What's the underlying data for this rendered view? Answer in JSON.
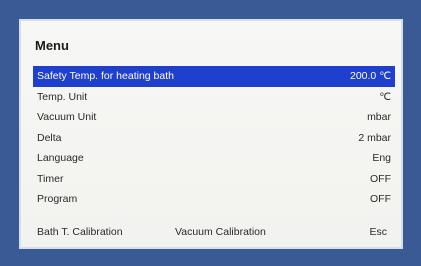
{
  "menu": {
    "title": "Menu",
    "items": [
      {
        "label": "Safety Temp. for heating bath",
        "value": "200.0 ℃",
        "selected": true
      },
      {
        "label": "Temp. Unit",
        "value": "℃"
      },
      {
        "label": "Vacuum Unit",
        "value": "mbar"
      },
      {
        "label": "Delta",
        "value": "2 mbar"
      },
      {
        "label": "Language",
        "value": "Eng"
      },
      {
        "label": "Timer",
        "value": "OFF"
      },
      {
        "label": "Program",
        "value": "OFF"
      }
    ]
  },
  "bottom": {
    "bath_calibration": "Bath T. Calibration",
    "vacuum_calibration": "Vacuum Calibration",
    "esc": "Esc"
  },
  "colors": {
    "frame": "#3a5a95",
    "highlight": "#1f3fcf"
  }
}
